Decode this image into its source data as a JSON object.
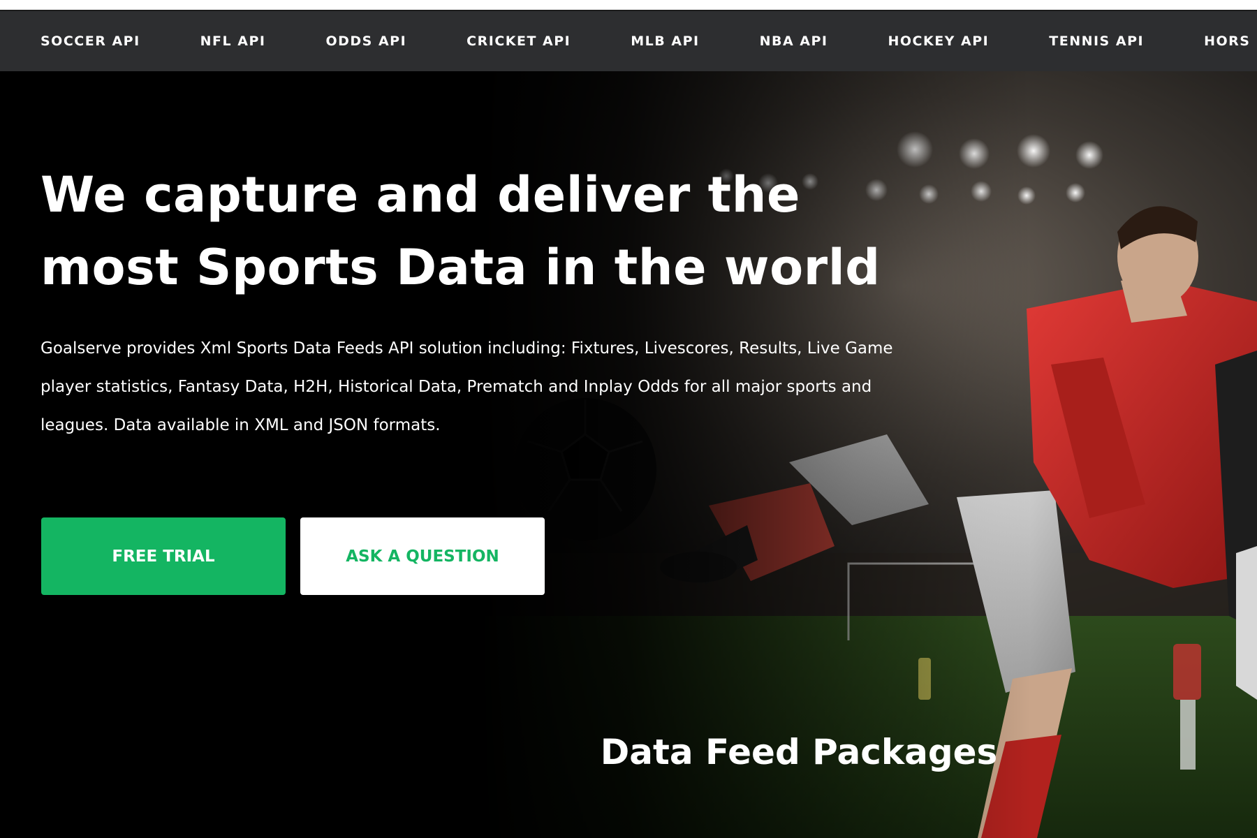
{
  "nav": {
    "items": [
      {
        "label": "SOCCER API"
      },
      {
        "label": "NFL API"
      },
      {
        "label": "ODDS API"
      },
      {
        "label": "CRICKET API"
      },
      {
        "label": "MLB API"
      },
      {
        "label": "NBA API"
      },
      {
        "label": "HOCKEY API"
      },
      {
        "label": "TENNIS API"
      },
      {
        "label": "HORS"
      }
    ]
  },
  "hero": {
    "title_line1": "We capture and deliver the",
    "title_line2": "most Sports Data in the world",
    "description": "Goalserve provides Xml Sports Data Feeds API solution including: Fixtures, Livescores, Results, Live Game player statistics, Fantasy Data, H2H, Historical Data, Prematch and Inplay Odds for all major sports and leagues. Data available in XML and JSON formats.",
    "free_trial_label": "FREE TRIAL",
    "ask_question_label": "ASK A QUESTION"
  },
  "packages": {
    "title": "Data Feed Packages"
  },
  "colors": {
    "accent_green": "#14b562",
    "navbar_bg": "#2d2e30",
    "hero_bg": "#000000"
  }
}
